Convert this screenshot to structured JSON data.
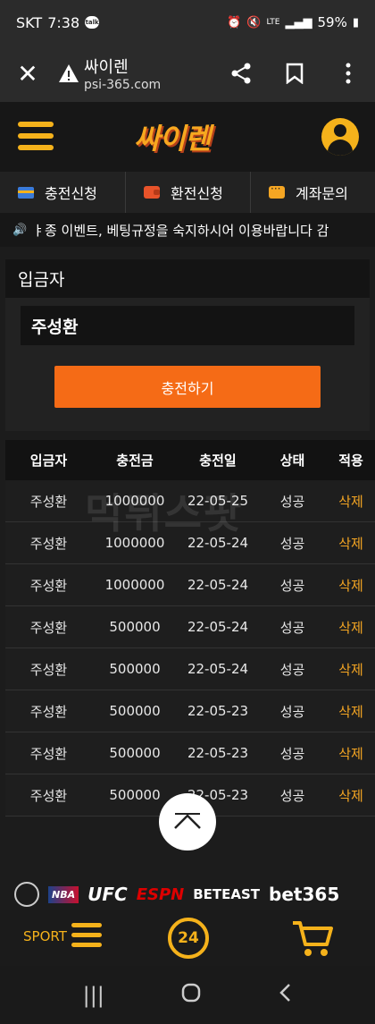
{
  "statusbar": {
    "carrier": "SKT",
    "time": "7:38",
    "talk_badge": "talk",
    "indicators": "LTE",
    "battery": "59%"
  },
  "browser": {
    "title": "싸이렌",
    "url": "psi-365.com"
  },
  "site": {
    "logo": "싸이렌"
  },
  "nav": {
    "tabs": [
      {
        "label": "충전신청",
        "icon": "card-icon"
      },
      {
        "label": "환전신청",
        "icon": "wallet-icon"
      },
      {
        "label": "계좌문의",
        "icon": "chat-icon"
      }
    ]
  },
  "marquee": {
    "text": "ㅑ종 이벤트, 베팅규정을 숙지하시어 이용바랍니다 감"
  },
  "form": {
    "section_title": "입금자",
    "depositor_value": "주성환",
    "submit_label": "충전하기"
  },
  "table": {
    "headers": [
      "입금자",
      "충전금",
      "충전일",
      "상태",
      "적용"
    ],
    "rows": [
      {
        "name": "주성환",
        "amount": "1000000",
        "date": "22-05-25",
        "status": "성공",
        "action": "삭제"
      },
      {
        "name": "주성환",
        "amount": "1000000",
        "date": "22-05-24",
        "status": "성공",
        "action": "삭제"
      },
      {
        "name": "주성환",
        "amount": "1000000",
        "date": "22-05-24",
        "status": "성공",
        "action": "삭제"
      },
      {
        "name": "주성환",
        "amount": "500000",
        "date": "22-05-24",
        "status": "성공",
        "action": "삭제"
      },
      {
        "name": "주성환",
        "amount": "500000",
        "date": "22-05-24",
        "status": "성공",
        "action": "삭제"
      },
      {
        "name": "주성환",
        "amount": "500000",
        "date": "22-05-23",
        "status": "성공",
        "action": "삭제"
      },
      {
        "name": "주성환",
        "amount": "500000",
        "date": "22-05-23",
        "status": "성공",
        "action": "삭제"
      },
      {
        "name": "주성환",
        "amount": "500000",
        "date": "22-05-23",
        "status": "성공",
        "action": "삭제"
      }
    ]
  },
  "watermark": "먹튀스팟",
  "sponsors": [
    "NBA",
    "UFC",
    "ESPN",
    "BETEAST",
    "bet365"
  ],
  "bottom": {
    "sport_label": "SPORT",
    "support_label": "24"
  },
  "colors": {
    "accent": "#f5b21b",
    "button": "#f56b16",
    "delete": "#f5a623"
  }
}
